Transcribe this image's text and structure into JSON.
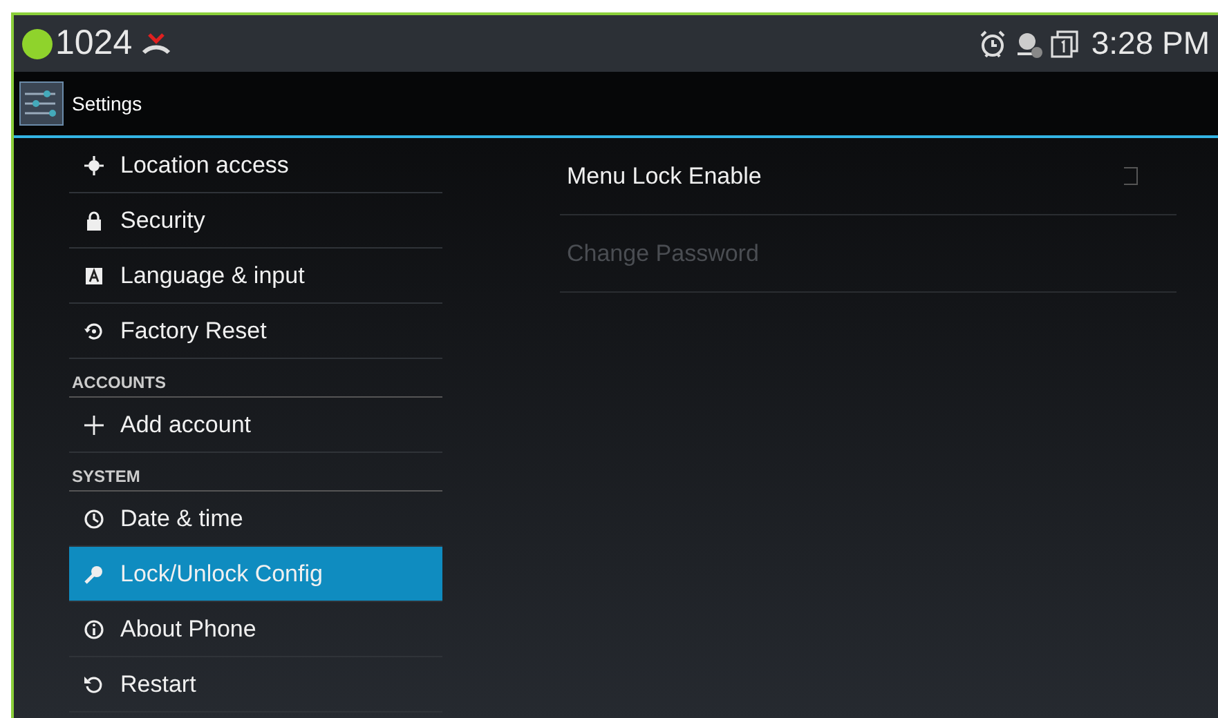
{
  "status_bar": {
    "presence": {
      "color": "#8fd32c"
    },
    "extension": "1024",
    "missed_call": true,
    "time": "3:28 PM"
  },
  "action_bar": {
    "title": "Settings"
  },
  "sidebar": {
    "items": [
      {
        "kind": "item",
        "label": "Location access",
        "selected": false
      },
      {
        "kind": "item",
        "label": "Security",
        "selected": false
      },
      {
        "kind": "item",
        "label": "Language & input",
        "selected": false
      },
      {
        "kind": "item",
        "label": "Factory Reset",
        "selected": false
      },
      {
        "kind": "header",
        "label": "ACCOUNTS"
      },
      {
        "kind": "item",
        "label": "Add account",
        "selected": false
      },
      {
        "kind": "header",
        "label": "SYSTEM"
      },
      {
        "kind": "item",
        "label": "Date & time",
        "selected": false
      },
      {
        "kind": "item",
        "label": "Lock/Unlock Config",
        "selected": true
      },
      {
        "kind": "item",
        "label": "About Phone",
        "selected": false
      },
      {
        "kind": "item",
        "label": "Restart",
        "selected": false
      }
    ]
  },
  "detail": {
    "items": [
      {
        "kind": "checkbox",
        "label": "Menu Lock Enable",
        "checked": false,
        "disabled": false
      },
      {
        "kind": "link",
        "label": "Change Password",
        "disabled": true
      }
    ]
  }
}
